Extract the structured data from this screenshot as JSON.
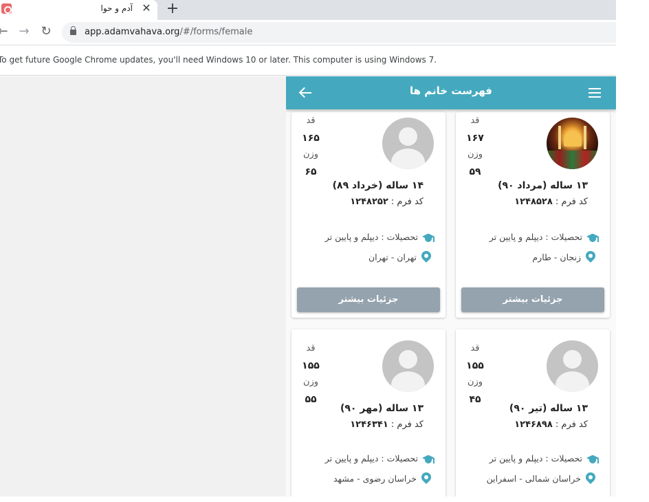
{
  "browser": {
    "tab_title": "آدم و حوا",
    "tab_close": "✕",
    "new_tab": "+",
    "nav_back": "←",
    "nav_forward": "→",
    "nav_reload": "↻",
    "url_host": "app.adamvahava.org",
    "url_path": "/#/forms/female",
    "infobar_text": "To get future Google Chrome updates, you'll need Windows 10 or later. This computer is using Windows 7."
  },
  "app": {
    "title": "فهرست خانم ها",
    "accent_color": "#44a9be",
    "button_color": "#94a3ad"
  },
  "labels": {
    "height": "قد",
    "weight": "وزن",
    "form_code": "کد فرم :",
    "details_button": "جزئیات بیشتر"
  },
  "cards": [
    {
      "height": "۱۶۷",
      "weight": "۵۹",
      "age": "۱۳ ساله (مرداد ۹۰)",
      "form_code": "۱۲۴۸۵۲۸",
      "education": "تحصیلات : دیپلم و پایین تر",
      "location": "زنجان - طارم",
      "avatar": "photo"
    },
    {
      "height": "۱۶۵",
      "weight": "۶۵",
      "age": "۱۴ ساله (خرداد ۸۹)",
      "form_code": "۱۲۴۸۲۵۲",
      "education": "تحصیلات : دیپلم و پایین تر",
      "location": "تهران - تهران",
      "avatar": "placeholder"
    },
    {
      "height": "۱۵۵",
      "weight": "۴۵",
      "age": "۱۳ ساله (تیر ۹۰)",
      "form_code": "۱۲۴۶۸۹۸",
      "education": "تحصیلات : دیپلم و پایین تر",
      "location": "خراسان شمالی - اسفراین",
      "avatar": "placeholder"
    },
    {
      "height": "۱۵۵",
      "weight": "۵۵",
      "age": "۱۳ ساله (مهر ۹۰)",
      "form_code": "۱۲۴۶۳۴۱",
      "education": "تحصیلات : دیپلم و پایین تر",
      "location": "خراسان رضوی - مشهد",
      "avatar": "placeholder"
    }
  ]
}
